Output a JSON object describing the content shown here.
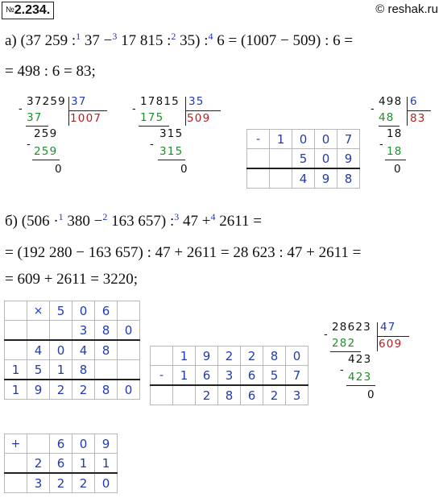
{
  "header": {
    "problem_prefix": "№",
    "problem_number": "2.234.",
    "site": "© reshak.ru"
  },
  "part_a": {
    "marker": "а)",
    "expr_parts": [
      "(37 259 :",
      "1",
      " 37 −",
      "3",
      " 17 815 :",
      "2",
      " 35) :",
      "4",
      " 6 = (1007 − 509) : 6 ="
    ],
    "line2": "= 498 : 6 = 83;",
    "div1": {
      "dividend": "37259",
      "divisor": "37",
      "quotient": "1007",
      "steps": [
        "37",
        "259",
        "259",
        "0"
      ]
    },
    "div2": {
      "dividend": "17815",
      "divisor": "35",
      "quotient": "509",
      "steps": [
        "175",
        "315",
        "315",
        "0"
      ]
    },
    "sub_table": {
      "op": "-",
      "row1": [
        "1",
        "0",
        "0",
        "7"
      ],
      "row2": [
        "5",
        "0",
        "9"
      ],
      "row3": [
        "4",
        "9",
        "8"
      ]
    },
    "div3": {
      "dividend": "498",
      "divisor": "6",
      "quotient": "83",
      "steps": [
        "48",
        "18",
        "18",
        "0"
      ]
    }
  },
  "part_b": {
    "marker": "б)",
    "expr_parts": [
      "(506 ·",
      "1",
      " 380 −",
      "2",
      " 163 657) :",
      "3",
      " 47 +",
      "4",
      " 2611 ="
    ],
    "line2": "= (192 280 − 163 657) : 47 + 2611 = 28 623 : 47 + 2611 =",
    "line3": "= 609 + 2611 = 3220;",
    "mul_table": {
      "op": "×",
      "row1": [
        "5",
        "0",
        "6"
      ],
      "row2": [
        "3",
        "8",
        "0"
      ],
      "row3": [
        "4",
        "0",
        "4",
        "8"
      ],
      "row4": [
        "1",
        "5",
        "1",
        "8"
      ],
      "row5": [
        "1",
        "9",
        "2",
        "2",
        "8",
        "0"
      ]
    },
    "sub_table": {
      "op": "-",
      "row1": [
        "1",
        "9",
        "2",
        "2",
        "8",
        "0"
      ],
      "row2": [
        "1",
        "6",
        "3",
        "6",
        "5",
        "7"
      ],
      "row3": [
        "2",
        "8",
        "6",
        "2",
        "3"
      ]
    },
    "div4": {
      "dividend": "28623",
      "divisor": "47",
      "quotient": "609",
      "steps": [
        "282",
        "423",
        "423",
        "0"
      ]
    },
    "add_table": {
      "op": "+",
      "row1": [
        "6",
        "0",
        "9"
      ],
      "row2": [
        "2",
        "6",
        "1",
        "1"
      ],
      "row3": [
        "3",
        "2",
        "2",
        "0"
      ]
    }
  }
}
